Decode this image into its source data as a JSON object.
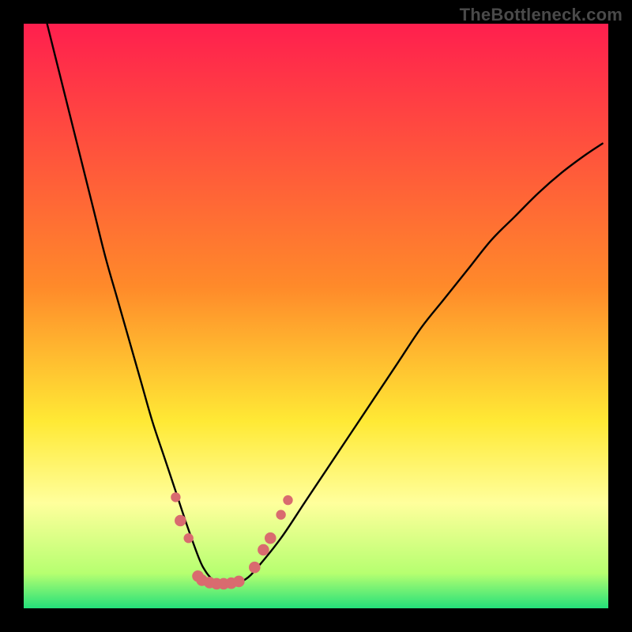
{
  "watermark": "TheBottleneck.com",
  "colors": {
    "frame": "#000000",
    "top_red": "#ff1f4e",
    "mid_orange": "#ff8a2a",
    "mid_yellow": "#ffe935",
    "pale_yellow": "#ffff9c",
    "bottom_green": "#24e07a",
    "curve": "#000000",
    "marker": "#d96b6f"
  },
  "chart_data": {
    "type": "line",
    "title": "",
    "xlabel": "",
    "ylabel": "",
    "xlim": [
      0,
      100
    ],
    "ylim": [
      0,
      100
    ],
    "series": [
      {
        "name": "bottleneck-curve",
        "x": [
          4,
          6,
          8,
          10,
          12,
          14,
          16,
          18,
          20,
          22,
          24,
          26,
          28,
          30,
          31,
          32,
          33,
          34,
          36,
          38,
          40,
          44,
          48,
          52,
          56,
          60,
          64,
          68,
          72,
          76,
          80,
          84,
          88,
          92,
          96,
          99
        ],
        "y": [
          100,
          92,
          84,
          76,
          68,
          60,
          53,
          46,
          39,
          32,
          26,
          20,
          14,
          8.5,
          6.5,
          5.2,
          4.5,
          4.2,
          4.2,
          5.0,
          7.0,
          12,
          18,
          24,
          30,
          36,
          42,
          48,
          53,
          58,
          63,
          67,
          71,
          74.5,
          77.5,
          79.5
        ]
      }
    ],
    "markers": [
      {
        "x": 26.0,
        "y": 19,
        "r": 1.2
      },
      {
        "x": 26.8,
        "y": 15,
        "r": 1.4
      },
      {
        "x": 28.2,
        "y": 12,
        "r": 1.2
      },
      {
        "x": 29.8,
        "y": 5.5,
        "r": 1.4
      },
      {
        "x": 30.5,
        "y": 4.8,
        "r": 1.4
      },
      {
        "x": 31.8,
        "y": 4.4,
        "r": 1.4
      },
      {
        "x": 33.0,
        "y": 4.2,
        "r": 1.4
      },
      {
        "x": 34.2,
        "y": 4.2,
        "r": 1.4
      },
      {
        "x": 35.5,
        "y": 4.3,
        "r": 1.4
      },
      {
        "x": 36.8,
        "y": 4.6,
        "r": 1.4
      },
      {
        "x": 39.5,
        "y": 7.0,
        "r": 1.4
      },
      {
        "x": 41.0,
        "y": 10.0,
        "r": 1.4
      },
      {
        "x": 42.2,
        "y": 12.0,
        "r": 1.4
      },
      {
        "x": 44.0,
        "y": 16.0,
        "r": 1.2
      },
      {
        "x": 45.2,
        "y": 18.5,
        "r": 1.2
      }
    ],
    "gradient_bands": [
      {
        "y": 100,
        "color": "#ff1f4e"
      },
      {
        "y": 55,
        "color": "#ff8a2a"
      },
      {
        "y": 32,
        "color": "#ffe935"
      },
      {
        "y": 18,
        "color": "#ffff9c"
      },
      {
        "y": 6,
        "color": "#b6ff70"
      },
      {
        "y": 0,
        "color": "#24e07a"
      }
    ]
  }
}
